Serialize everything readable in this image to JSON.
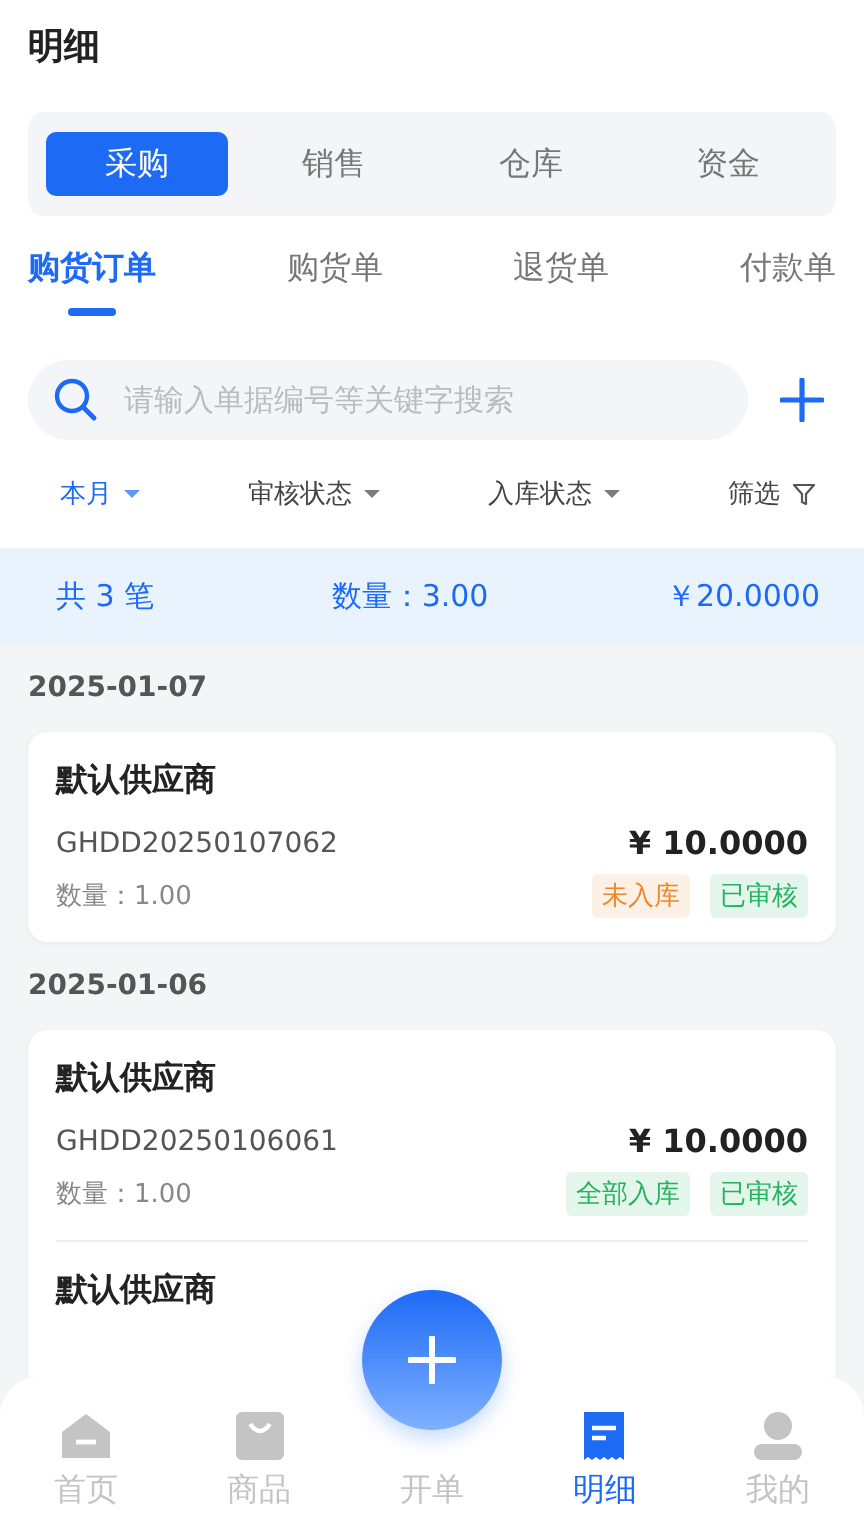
{
  "title": "明细",
  "categories": [
    {
      "label": "采购",
      "selected": true
    },
    {
      "label": "销售",
      "selected": false
    },
    {
      "label": "仓库",
      "selected": false
    },
    {
      "label": "资金",
      "selected": false
    }
  ],
  "doc_tabs": [
    {
      "label": "购货订单",
      "selected": true
    },
    {
      "label": "购货单",
      "selected": false
    },
    {
      "label": "退货单",
      "selected": false
    },
    {
      "label": "付款单",
      "selected": false
    }
  ],
  "search": {
    "placeholder": "请输入单据编号等关键字搜索"
  },
  "filters": [
    {
      "label": "本月",
      "kind": "dropdown",
      "active": true
    },
    {
      "label": "审核状态",
      "kind": "dropdown",
      "active": false
    },
    {
      "label": "入库状态",
      "kind": "dropdown",
      "active": false
    },
    {
      "label": "筛选",
      "kind": "filter",
      "active": false
    }
  ],
  "summary": {
    "count": "共 3 笔",
    "quantity": "数量：3.00",
    "amount": "￥20.0000"
  },
  "groups": [
    {
      "date": "2025-01-07",
      "orders": [
        {
          "supplier": "默认供应商",
          "number": "GHDD20250107062",
          "amount": "¥ 10.0000",
          "quantity": "数量：1.00",
          "tags": [
            {
              "label": "未入库",
              "color": "#f0862a"
            },
            {
              "label": "已审核",
              "color": "#22b35e"
            }
          ]
        }
      ]
    },
    {
      "date": "2025-01-06",
      "orders": [
        {
          "supplier": "默认供应商",
          "number": "GHDD20250106061",
          "amount": "¥ 10.0000",
          "quantity": "数量：1.00",
          "tags": [
            {
              "label": "全部入库",
              "color": "#22b35e"
            },
            {
              "label": "已审核",
              "color": "#22b35e"
            }
          ]
        },
        {
          "supplier": "默认供应商"
        }
      ]
    }
  ],
  "nav": [
    {
      "label": "首页",
      "kind": "home",
      "selected": false
    },
    {
      "label": "商品",
      "kind": "bag",
      "selected": false
    },
    {
      "label": "开单",
      "kind": "create",
      "selected": false
    },
    {
      "label": "明细",
      "kind": "doc",
      "selected": true
    },
    {
      "label": "我的",
      "kind": "person",
      "selected": false
    }
  ]
}
